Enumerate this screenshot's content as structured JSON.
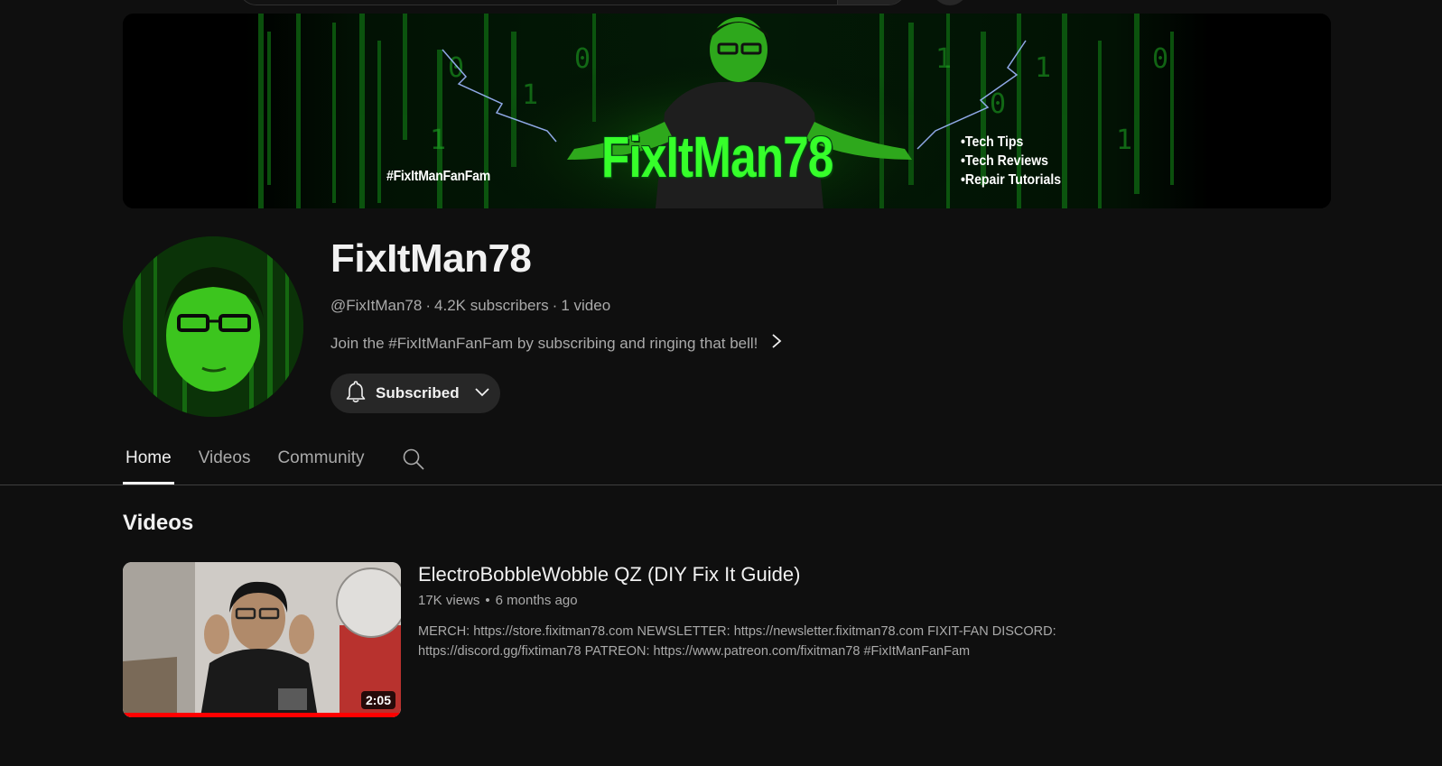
{
  "colors": {
    "background": "#0f0f0f",
    "text_primary": "#f1f1f1",
    "text_secondary": "#aaaaaa",
    "button_bg": "#272727",
    "progress_red": "#ff0000",
    "matrix_green": "#36ff2a"
  },
  "banner": {
    "hashtag": "#FixItManFanFam",
    "title": "FixItMan78",
    "bullets": [
      "•Tech Tips",
      "•Tech Reviews",
      "•Repair Tutorials"
    ]
  },
  "channel": {
    "name": "FixItMan78",
    "handle": "@FixItMan78",
    "subscribers": "4.2K subscribers",
    "video_count": "1 video",
    "separator": "·",
    "description": "Join the #FixItManFanFam by subscribing and ringing that bell!",
    "subscribe_label": "Subscribed"
  },
  "tabs": [
    {
      "label": "Home",
      "active": true
    },
    {
      "label": "Videos",
      "active": false
    },
    {
      "label": "Community",
      "active": false
    }
  ],
  "sections": {
    "videos_title": "Videos"
  },
  "video": {
    "title": "ElectroBobbleWobble QZ (DIY Fix It Guide)",
    "views": "17K views",
    "age": "6 months ago",
    "dot": "•",
    "description": "MERCH: https://store.fixitman78.com NEWSLETTER: https://newsletter.fixitman78.com FIXIT-FAN DISCORD: https://discord.gg/fixtiman78 PATREON: https://www.patreon.com/fixitman78 #FixItManFanFam",
    "duration": "2:05",
    "watch_progress": 1.0
  }
}
